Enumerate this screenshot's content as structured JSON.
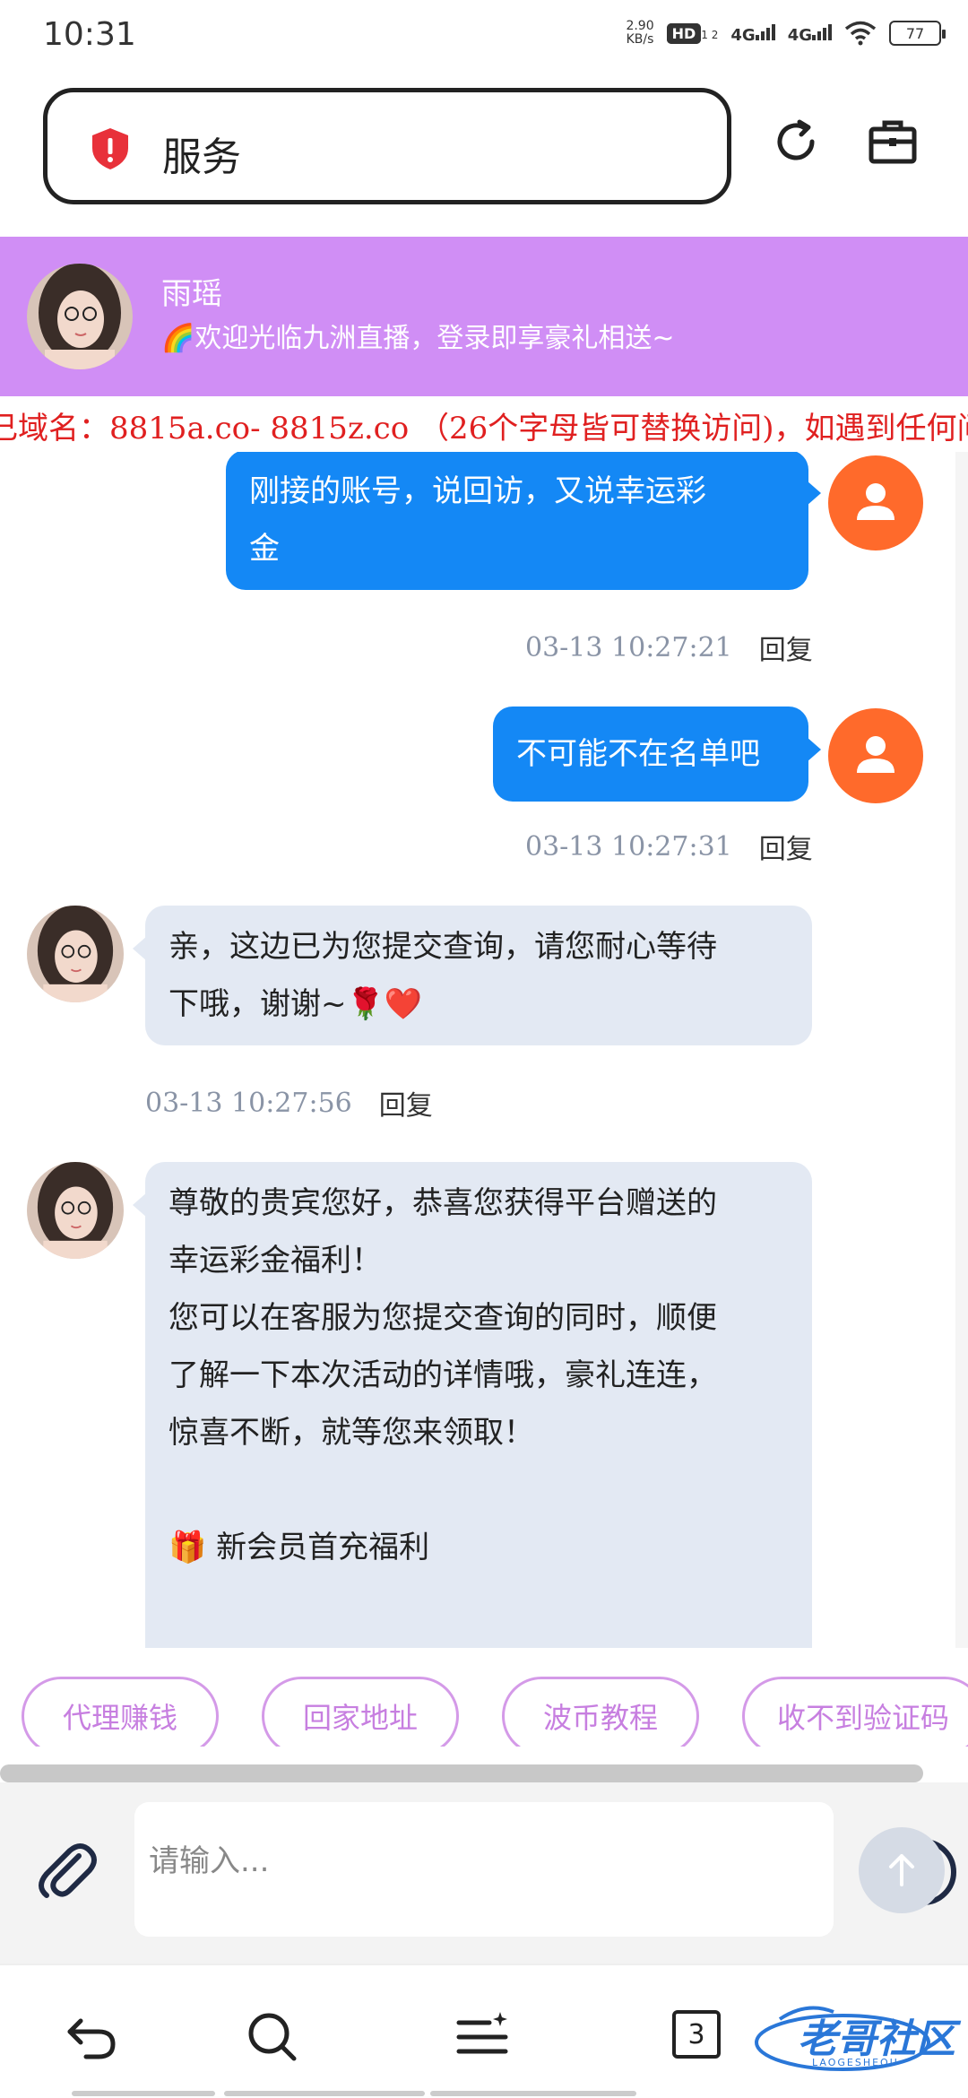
{
  "status_bar": {
    "time": "10:31",
    "net_speed_value": "2.90",
    "net_speed_unit": "KB/s",
    "hd": "HD",
    "hd_sub": "1 2",
    "sig1": "4G",
    "sig2": "4G",
    "battery": "77"
  },
  "browser": {
    "url_title": "服务",
    "shield_color": "#e8313a"
  },
  "chat": {
    "agent_name": "雨瑶",
    "welcome": "🌈欢迎光临九洲直播，登录即享豪礼相送~",
    "marquee": "己域名：8815a.co- 8815z.co （26个字母皆可替换访问)，如遇到任何问"
  },
  "messages": [
    {
      "side": "out",
      "lines": [
        "刚接的账号，说回访，又说幸运彩",
        "金"
      ],
      "time": "03-13 10:27:21",
      "reply": "回复"
    },
    {
      "side": "out",
      "lines": [
        "不可能不在名单吧"
      ],
      "time": "03-13 10:27:31",
      "reply": "回复"
    },
    {
      "side": "in",
      "lines": [
        "亲，这边已为您提交查询，请您耐心等待",
        "下哦，谢谢~🌹❤️"
      ],
      "time": "03-13 10:27:56",
      "reply": "回复"
    },
    {
      "side": "in",
      "lines": [
        "尊敬的贵宾您好，恭喜您获得平台赠送的",
        "幸运彩金福利！",
        "您可以在客服为您提交查询的同时，顺便",
        "了解一下本次活动的详情哦，豪礼连连，",
        "惊喜不断，就等您来领取！",
        "",
        "🎁 新会员首充福利"
      ]
    }
  ],
  "quick_replies": [
    "代理赚钱",
    "回家地址",
    "波币教程",
    "收不到验证码"
  ],
  "input": {
    "placeholder": "请输入..."
  },
  "nav": {
    "tab_count": "3"
  },
  "watermark": {
    "text": "老哥社区",
    "sub": "LAOGESHEQU"
  },
  "colors": {
    "header_purple": "#d08ef5",
    "out_bubble": "#1488f5",
    "in_bubble": "#e3e9f3",
    "user_avatar": "#ff6a2b",
    "marquee_red": "#e02020",
    "chip_purple": "#d49ae8"
  }
}
